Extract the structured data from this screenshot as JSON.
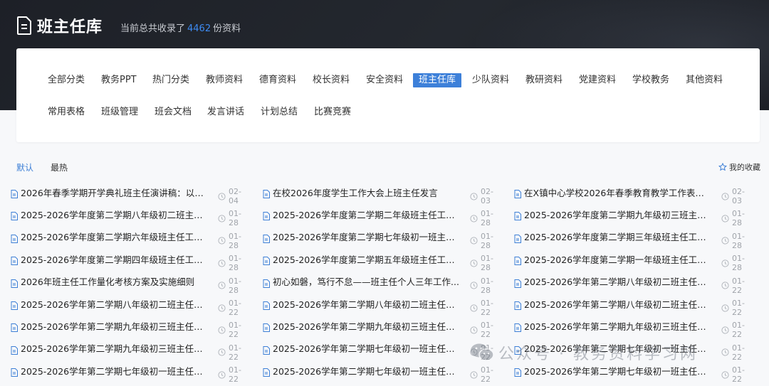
{
  "header": {
    "title": "班主任库",
    "count_prefix": "当前总共收录了",
    "count_value": "4462",
    "count_suffix": "份资料"
  },
  "categories": [
    {
      "label": "全部分类"
    },
    {
      "label": "教务PPT"
    },
    {
      "label": "热门分类"
    },
    {
      "label": "教师资料"
    },
    {
      "label": "德育资料"
    },
    {
      "label": "校长资料"
    },
    {
      "label": "安全资料"
    },
    {
      "label": "班主任库",
      "active": true
    },
    {
      "label": "少队资料"
    },
    {
      "label": "教研资料"
    },
    {
      "label": "党建资料"
    },
    {
      "label": "学校教务"
    },
    {
      "label": "其他资料"
    },
    {
      "label": "常用表格"
    },
    {
      "label": "班级管理"
    },
    {
      "label": "班会文档"
    },
    {
      "label": "发言讲话"
    },
    {
      "label": "计划总结"
    },
    {
      "label": "比赛竞赛"
    }
  ],
  "tabs": [
    {
      "label": "默认",
      "active": true
    },
    {
      "label": "最热"
    }
  ],
  "favorites_label": "我的收藏",
  "items": [
    {
      "title": "2026年春季学期开学典礼班主任演讲稿：以春...",
      "date": "02-04"
    },
    {
      "title": "在校2026年度学生工作大会上班主任发言",
      "date": "02-03"
    },
    {
      "title": "在X镇中心学校2026年春季教育教学工作表彰...",
      "date": "02-03"
    },
    {
      "title": "2025-2026学年度第二学期八年级初二班主任...",
      "date": "01-28"
    },
    {
      "title": "2025-2026学年度第二学期二年级班主任工作...",
      "date": "01-28"
    },
    {
      "title": "2025-2026学年度第二学期九年级初三班主任...",
      "date": "01-28"
    },
    {
      "title": "2025-2026学年度第二学期六年级班主任工作...",
      "date": "01-28"
    },
    {
      "title": "2025-2026学年度第二学期七年级初一班主任...",
      "date": "01-28"
    },
    {
      "title": "2025-2026学年度第二学期三年级班主任工作...",
      "date": "01-28"
    },
    {
      "title": "2025-2026学年度第二学期四年级班主任工作...",
      "date": "01-28"
    },
    {
      "title": "2025-2026学年度第二学期五年级班主任工作...",
      "date": "01-28"
    },
    {
      "title": "2025-2026学年度第二学期一年级班主任工作...",
      "date": "01-28"
    },
    {
      "title": "2026年班主任工作量化考核方案及实施细则",
      "date": "01-28"
    },
    {
      "title": "初心如磐，笃行不怠——班主任个人三年工作...",
      "date": "01-28"
    },
    {
      "title": "2025-2026学年第二学期八年级初二班主任工...",
      "date": "01-22"
    },
    {
      "title": "2025-2026学年第二学期八年级初二班主任工...",
      "date": "01-22"
    },
    {
      "title": "2025-2026学年第二学期八年级初二班主任工...",
      "date": "01-22"
    },
    {
      "title": "2025-2026学年第二学期八年级初二班主任工...",
      "date": "01-22"
    },
    {
      "title": "2025-2026学年第二学期九年级初三班主任工...",
      "date": "01-22"
    },
    {
      "title": "2025-2026学年第二学期九年级初三班主任工...",
      "date": "01-22"
    },
    {
      "title": "2025-2026学年第二学期九年级初三班主任工...",
      "date": "01-22"
    },
    {
      "title": "2025-2026学年第二学期九年级初三班主任工...",
      "date": "01-22"
    },
    {
      "title": "2025-2026学年第二学期七年级初一班主任带...",
      "date": "01-22"
    },
    {
      "title": "2025-2026学年第二学期七年级初一班主任工...",
      "date": "01-22"
    },
    {
      "title": "2025-2026学年第二学期七年级初一班主任工...",
      "date": "01-22"
    },
    {
      "title": "2025-2026学年第二学期七年级初一班主任工...",
      "date": "01-22"
    },
    {
      "title": "2025-2026学年第二学期七年级初一班主任工...",
      "date": "01-22"
    }
  ],
  "watermark": "公众号 · 教务资料学习网"
}
